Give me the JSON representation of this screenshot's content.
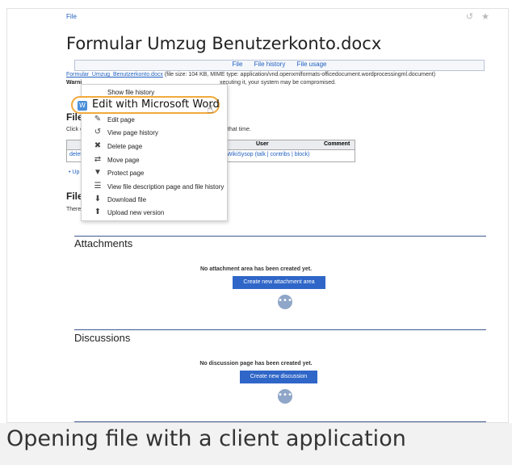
{
  "breadcrumb": "File",
  "title": "Formular Umzug Benutzerkonto.docx",
  "tabs": [
    "File",
    "File history",
    "File usage"
  ],
  "fileinfo": {
    "link": "Formular_Umzug_Benutzerkonto.docx",
    "details": "(file size: 104 KB, MIME type: application/vnd.openxmlformats-officedocument.wordprocessingml.document)"
  },
  "warning": {
    "label": "Warni",
    "text": "xecuting it, your system may be compromised."
  },
  "history_section": {
    "heading": "File",
    "click_prefix": "Click o",
    "click_suffix": "that time.",
    "col_user": "User",
    "col_comment": "Comment",
    "row_action": "delete",
    "row_user": "WikiSysop (talk | contribs | block)",
    "bullet": "Up"
  },
  "usage_section": {
    "heading": "File",
    "text": "There"
  },
  "context_menu": {
    "highlighted": "Edit with Microsoft Word",
    "items": [
      {
        "label": "Show file history",
        "icon": "none"
      },
      {
        "label": "Edit page",
        "icon": "pencil-icon"
      },
      {
        "label": "View page history",
        "icon": "history-icon"
      },
      {
        "label": "Delete page",
        "icon": "trash-icon"
      },
      {
        "label": "Move page",
        "icon": "move-icon"
      },
      {
        "label": "Protect page",
        "icon": "shield-icon"
      },
      {
        "label": "View file description page and file history",
        "icon": "document-icon"
      },
      {
        "label": "Download file",
        "icon": "download-icon"
      },
      {
        "label": "Upload new version",
        "icon": "upload-icon"
      }
    ]
  },
  "attachments": {
    "heading": "Attachments",
    "empty": "No attachment area has been created yet.",
    "button": "Create new attachment area"
  },
  "discussions": {
    "heading": "Discussions",
    "empty": "No discussion page has been created yet.",
    "button": "Create new discussion"
  },
  "caption": "Opening file with a client application",
  "colors": {
    "accent": "#2f66c8",
    "highlight": "#f2a93b",
    "link": "#1f5fbf"
  }
}
